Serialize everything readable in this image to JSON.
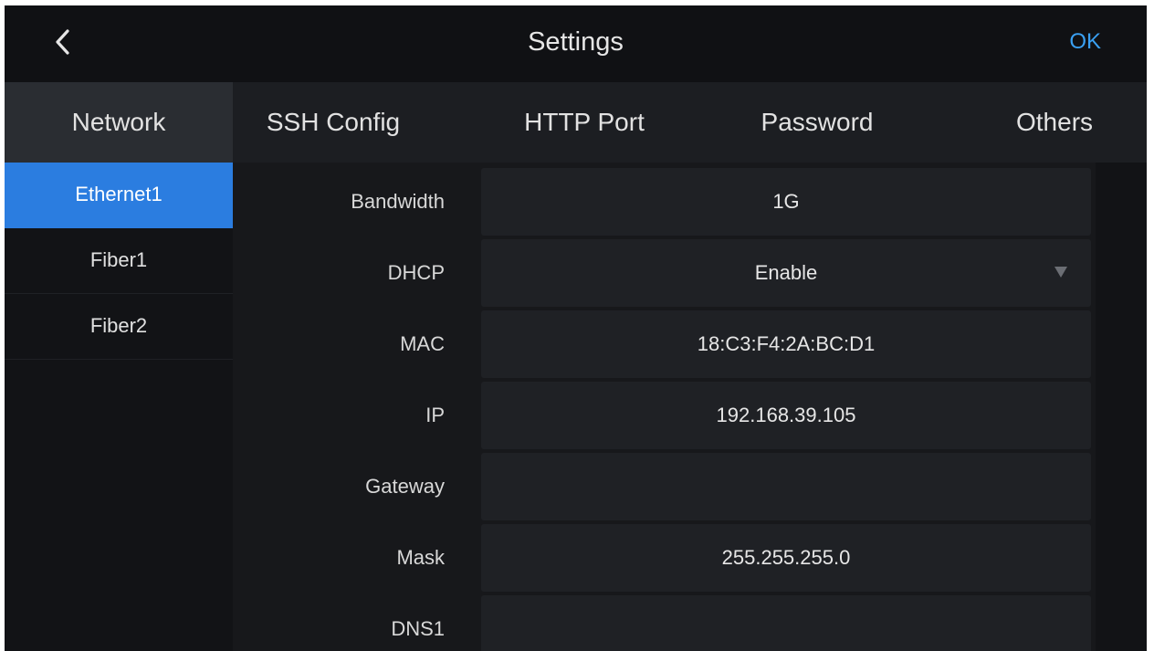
{
  "header": {
    "title": "Settings",
    "ok_label": "OK",
    "back_icon": "chevron-left-icon"
  },
  "tabs": [
    {
      "label": "Network",
      "active": true
    },
    {
      "label": "SSH Config",
      "active": false
    },
    {
      "label": "HTTP Port",
      "active": false
    },
    {
      "label": "Password",
      "active": false
    },
    {
      "label": "Others",
      "active": false
    }
  ],
  "sidebar": {
    "items": [
      {
        "label": "Ethernet1",
        "active": true
      },
      {
        "label": "Fiber1",
        "active": false
      },
      {
        "label": "Fiber2",
        "active": false
      }
    ]
  },
  "form": {
    "fields": [
      {
        "label": "Bandwidth",
        "value": "1G"
      },
      {
        "label": "DHCP",
        "value": "Enable",
        "dropdown": true
      },
      {
        "label": "MAC",
        "value": "18:C3:F4:2A:BC:D1"
      },
      {
        "label": "IP",
        "value": "192.168.39.105"
      },
      {
        "label": "Gateway",
        "value": ""
      },
      {
        "label": "Mask",
        "value": "255.255.255.0"
      },
      {
        "label": "DNS1",
        "value": ""
      }
    ]
  },
  "colors": {
    "accent": "#2b7de0",
    "ok_text": "#3aa0f2",
    "background": "#121316"
  }
}
